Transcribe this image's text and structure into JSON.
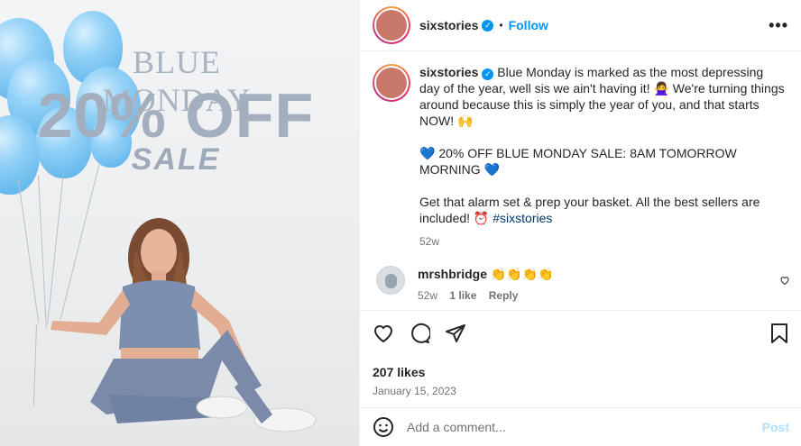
{
  "promo": {
    "line1": "BLUE MONDAY",
    "line2": "20% OFF",
    "line3": "SALE"
  },
  "header": {
    "username": "sixstories",
    "dot": "•",
    "follow_label": "Follow",
    "more_label": "•••"
  },
  "caption": {
    "username": "sixstories",
    "para1": "Blue Monday is marked as the most depressing day of the year, well sis we ain't having it! 🙅‍♀️ We're turning things around because this is simply the year of you, and that starts NOW! 🙌",
    "para2": "💙 20% OFF BLUE MONDAY SALE: 8AM TOMORROW MORNING 💙",
    "para3": "Get that alarm set & prep your basket. All the best sellers are included! ⏰",
    "hashtag": "#sixstories",
    "time": "52w"
  },
  "comment": {
    "username": "mrshbridge",
    "text": "👏👏👏👏",
    "time": "52w",
    "likes": "1 like",
    "reply": "Reply"
  },
  "post": {
    "likes": "207 likes",
    "date": "January 15, 2023"
  },
  "add_comment": {
    "placeholder": "Add a comment...",
    "post_label": "Post"
  },
  "colors": {
    "accent": "#0095f6",
    "balloon": "#8fd0f7",
    "promo_text": "#a3afbf"
  }
}
